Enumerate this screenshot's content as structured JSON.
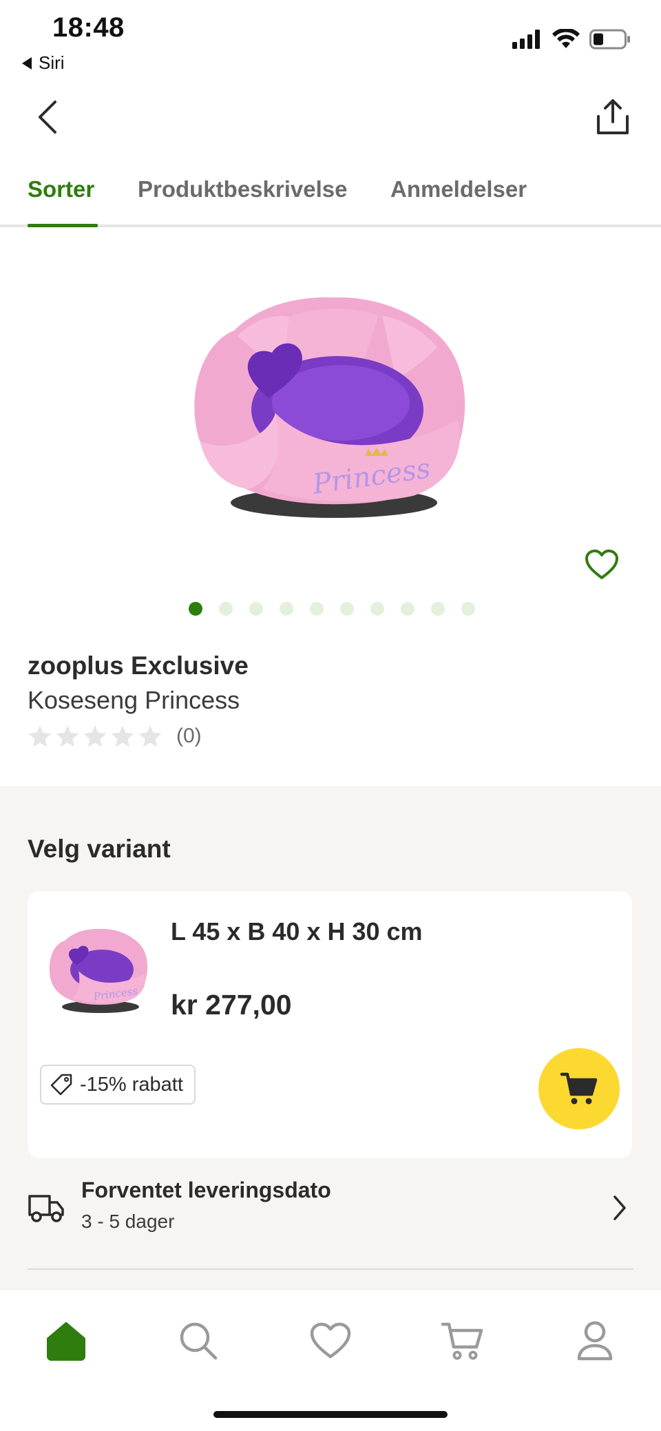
{
  "status_bar": {
    "time": "18:48",
    "back_app": "Siri"
  },
  "tabs": [
    {
      "label": "Sorter",
      "active": true
    },
    {
      "label": "Produktbeskrivelse",
      "active": false
    },
    {
      "label": "Anmeldelser",
      "active": false
    }
  ],
  "product": {
    "image_icon": "dog-bed-image",
    "image_text": "Princess",
    "carousel": {
      "total": 10,
      "current": 1
    },
    "brand": "zooplus Exclusive",
    "name": "Koseseng Princess",
    "rating": {
      "value": 0,
      "max": 5,
      "count_label": "(0)"
    }
  },
  "variant": {
    "section_title": "Velg variant",
    "size": "L 45 x B 40 x H 30 cm",
    "price": "kr 277,00",
    "discount": "-15% rabatt"
  },
  "delivery": {
    "title": "Forventet leveringsdato",
    "subtitle": "3 - 5 dager"
  },
  "bottom_nav": [
    {
      "icon": "home-icon",
      "active": true
    },
    {
      "icon": "search-icon",
      "active": false
    },
    {
      "icon": "heart-icon",
      "active": false
    },
    {
      "icon": "cart-icon",
      "active": false
    },
    {
      "icon": "profile-icon",
      "active": false
    }
  ],
  "colors": {
    "accent_green": "#2e7d0e",
    "cart_yellow": "#fbd931",
    "section_bg": "#f6f5f2",
    "bed_pink": "#f2a9d0",
    "bed_purple": "#7a3cc4"
  }
}
